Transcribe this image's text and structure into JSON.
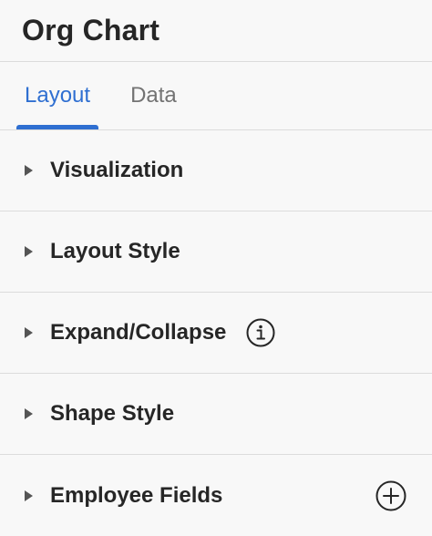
{
  "header": {
    "title": "Org Chart"
  },
  "tabs": [
    {
      "label": "Layout",
      "active": true
    },
    {
      "label": "Data",
      "active": false
    }
  ],
  "sections": [
    {
      "label": "Visualization"
    },
    {
      "label": "Layout Style"
    },
    {
      "label": "Expand/Collapse",
      "icon": "info-icon"
    },
    {
      "label": "Shape Style"
    },
    {
      "label": "Employee Fields",
      "icon": "add-circle-icon"
    }
  ],
  "colors": {
    "accent": "#2f6fd1",
    "background": "#f8f8f8",
    "divider": "#dcdcdc",
    "text": "#262626",
    "muted": "#737373"
  }
}
